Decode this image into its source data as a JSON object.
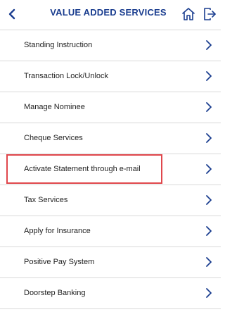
{
  "header": {
    "title": "VALUE ADDED SERVICES",
    "back_icon": "chevron-left-icon",
    "home_icon": "home-icon",
    "logout_icon": "logout-icon"
  },
  "colors": {
    "brand": "#1a3d8f",
    "highlight": "#e0474c",
    "divider": "#d9d9d9"
  },
  "menu": {
    "items": [
      {
        "label": "Standing Instruction"
      },
      {
        "label": "Transaction Lock/Unlock"
      },
      {
        "label": "Manage Nominee"
      },
      {
        "label": "Cheque Services"
      },
      {
        "label": "Activate Statement through e-mail",
        "highlighted": true
      },
      {
        "label": "Tax Services"
      },
      {
        "label": "Apply for Insurance"
      },
      {
        "label": "Positive Pay System"
      },
      {
        "label": "Doorstep Banking"
      }
    ]
  }
}
